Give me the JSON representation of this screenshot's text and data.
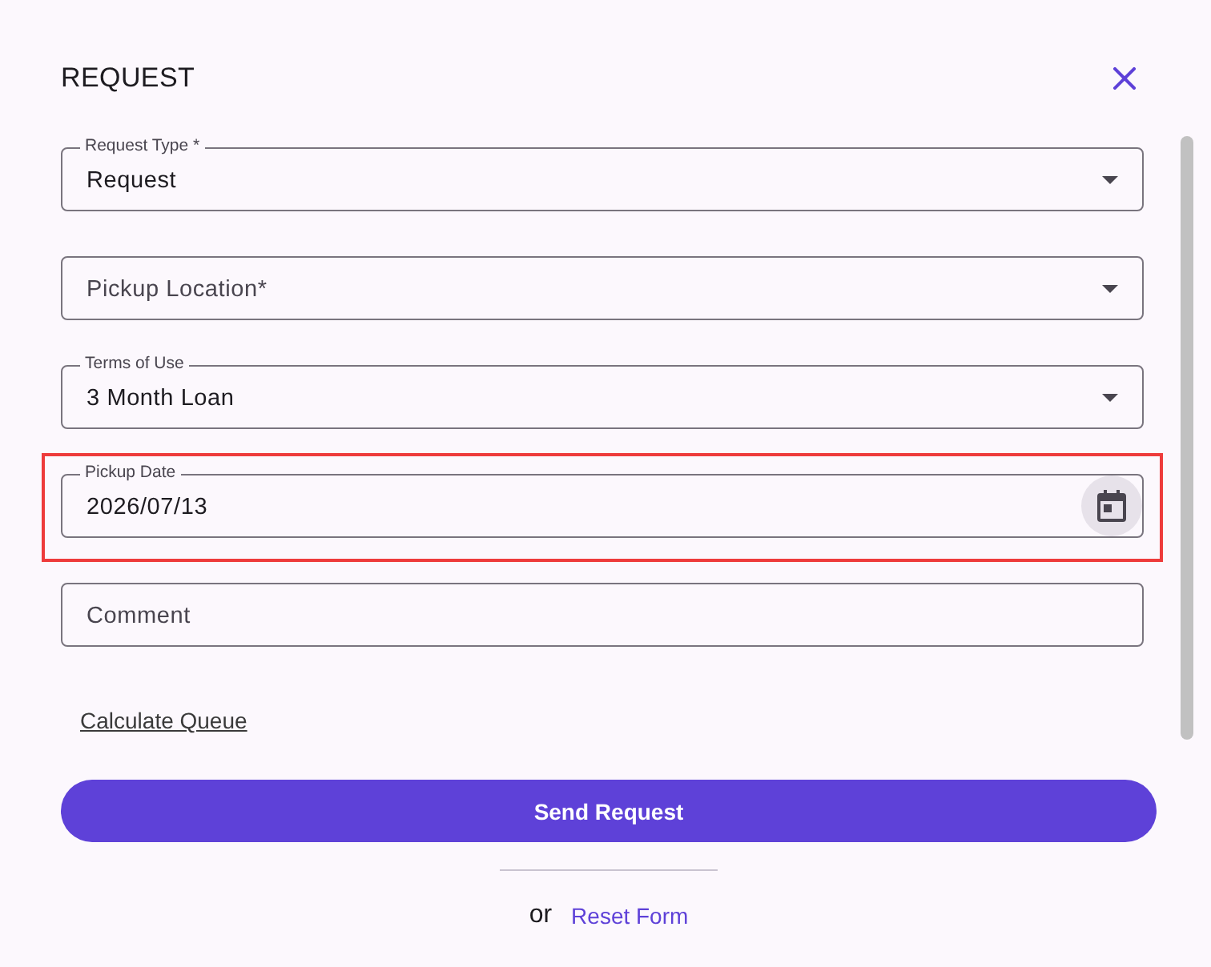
{
  "dialog": {
    "title": "REQUEST"
  },
  "fields": [
    {
      "kind": "select",
      "label": "Request Type *",
      "value": "Request",
      "highlighted": false
    },
    {
      "kind": "select",
      "placeholder": "Pickup Location*",
      "highlighted": false
    },
    {
      "kind": "select",
      "label": "Terms of Use",
      "value": "3 Month Loan",
      "highlighted": false
    },
    {
      "kind": "date",
      "label": "Pickup Date",
      "value": "2026/07/13",
      "highlighted": true
    },
    {
      "kind": "text",
      "placeholder": "Comment",
      "highlighted": false
    }
  ],
  "queue_link": "Calculate Queue",
  "submit_button": "Send Request",
  "footer": {
    "separator_text": "or",
    "reset_link": "Reset Form"
  }
}
